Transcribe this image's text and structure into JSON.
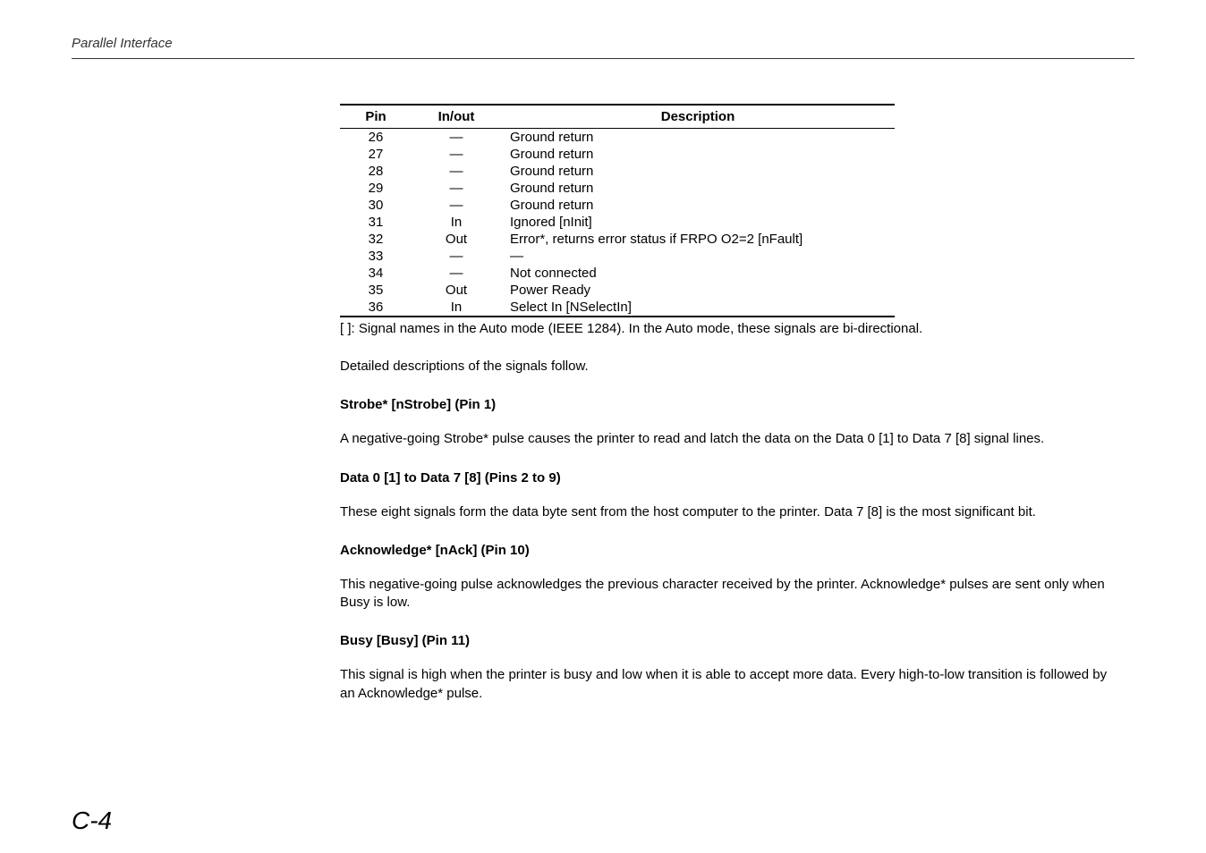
{
  "header": {
    "label": "Parallel Interface"
  },
  "table": {
    "headers": {
      "pin": "Pin",
      "inout": "In/out",
      "description": "Description"
    },
    "rows": [
      {
        "pin": "26",
        "inout": "—",
        "description": "Ground return"
      },
      {
        "pin": "27",
        "inout": "—",
        "description": "Ground return"
      },
      {
        "pin": "28",
        "inout": "—",
        "description": "Ground return"
      },
      {
        "pin": "29",
        "inout": "—",
        "description": "Ground return"
      },
      {
        "pin": "30",
        "inout": "—",
        "description": "Ground return"
      },
      {
        "pin": "31",
        "inout": "In",
        "description": "Ignored [nInit]"
      },
      {
        "pin": "32",
        "inout": "Out",
        "description": "Error*, returns error status if FRPO O2=2 [nFault]"
      },
      {
        "pin": "33",
        "inout": "—",
        "description": "—"
      },
      {
        "pin": "34",
        "inout": "—",
        "description": "Not connected"
      },
      {
        "pin": "35",
        "inout": "Out",
        "description": "Power Ready"
      },
      {
        "pin": "36",
        "inout": "In",
        "description": "Select In [NSelectIn]"
      }
    ],
    "note": "[ ]: Signal names in the Auto mode (IEEE 1284). In the Auto mode, these signals are bi-directional."
  },
  "intro_para": "Detailed descriptions of the signals follow.",
  "sections": [
    {
      "heading": "Strobe* [nStrobe] (Pin 1)",
      "body": "A negative-going Strobe* pulse causes the printer to read and latch the data on the Data 0 [1] to Data 7 [8] signal lines."
    },
    {
      "heading": "Data 0 [1] to Data 7 [8] (Pins 2 to 9)",
      "body": "These eight signals form the data byte sent from the host computer to the printer. Data 7 [8] is the most significant bit."
    },
    {
      "heading": "Acknowledge* [nAck] (Pin 10)",
      "body": "This negative-going pulse acknowledges the previous character received by the printer. Acknowledge* pulses are sent only when Busy is low."
    },
    {
      "heading": "Busy [Busy] (Pin 11)",
      "body": "This signal is high when the printer is busy and low when it is able to accept more data. Every high-to-low transition is followed by an Acknowledge* pulse."
    }
  ],
  "page_number": "C-4"
}
